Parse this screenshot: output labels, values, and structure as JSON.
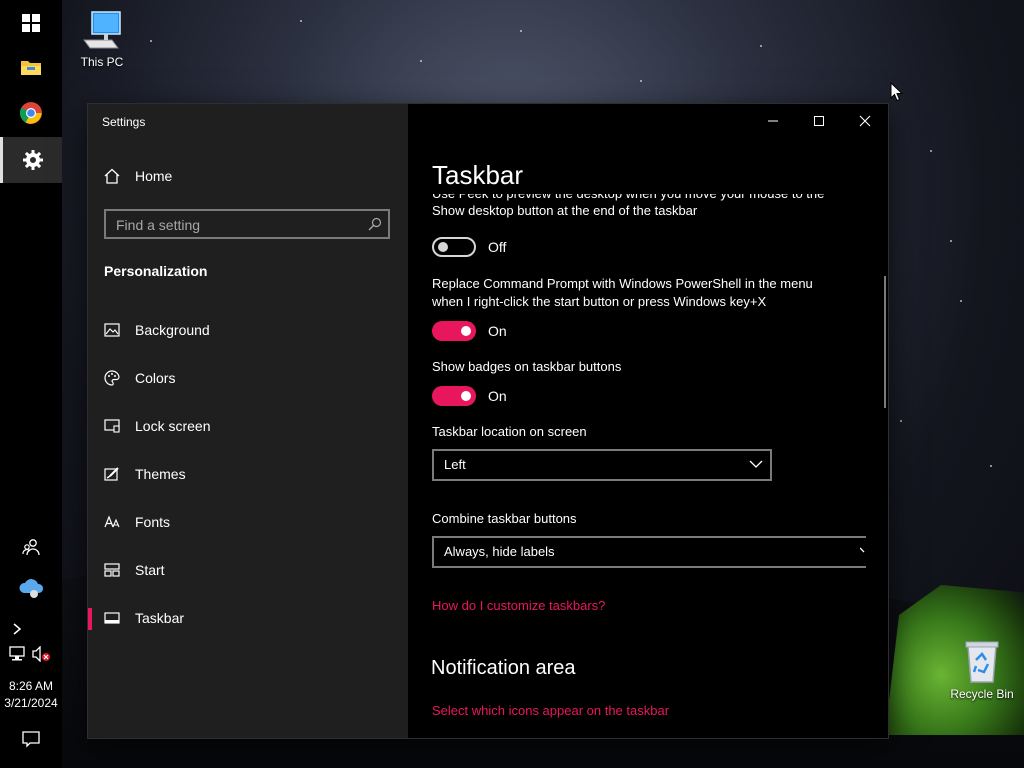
{
  "desktop": {
    "icons": [
      {
        "label": "This PC"
      },
      {
        "label": "Recycle Bin"
      }
    ]
  },
  "taskbar": {
    "time": "8:26 AM",
    "date": "3/21/2024"
  },
  "window": {
    "title": "Settings",
    "nav": {
      "home": "Home",
      "search_placeholder": "Find a setting",
      "section": "Personalization",
      "items": [
        {
          "label": "Background",
          "icon": "image-icon"
        },
        {
          "label": "Colors",
          "icon": "palette-icon"
        },
        {
          "label": "Lock screen",
          "icon": "lock-screen-icon"
        },
        {
          "label": "Themes",
          "icon": "brush-icon"
        },
        {
          "label": "Fonts",
          "icon": "font-icon"
        },
        {
          "label": "Start",
          "icon": "start-icon"
        },
        {
          "label": "Taskbar",
          "icon": "taskbar-icon",
          "selected": true
        }
      ]
    },
    "content": {
      "title": "Taskbar",
      "peek_line1": "Use Peek to preview the desktop when you move your mouse to the",
      "peek_line2": "Show desktop button at the end of the taskbar",
      "peek_state": "Off",
      "powershell_line1": "Replace Command Prompt with Windows PowerShell in the menu",
      "powershell_line2": "when I right-click the start button or press Windows key+X",
      "powershell_state": "On",
      "badges_label": "Show badges on taskbar buttons",
      "badges_state": "On",
      "location_label": "Taskbar location on screen",
      "location_value": "Left",
      "combine_label": "Combine taskbar buttons",
      "combine_value": "Always, hide labels",
      "help_link": "How do I customize taskbars?",
      "notification_title": "Notification area",
      "notification_link": "Select which icons appear on the taskbar"
    }
  },
  "colors": {
    "accent": "#e8175d",
    "nav_bg": "#1f1f1f",
    "content_bg": "#000000"
  }
}
